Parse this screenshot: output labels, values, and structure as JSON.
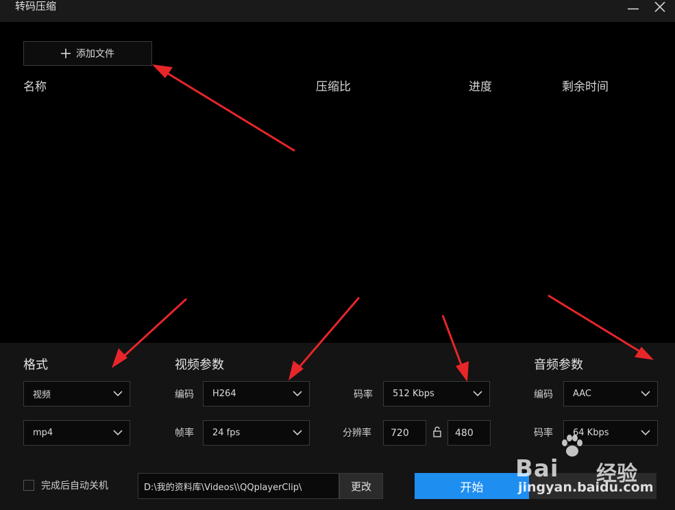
{
  "window": {
    "title": "转码压缩",
    "minimize_icon": "minimize-icon",
    "close_icon": "close-icon"
  },
  "toolbar": {
    "add_file_label": "添加文件",
    "add_icon": "plus-icon"
  },
  "file_table": {
    "columns": [
      "名称",
      "压缩比",
      "进度",
      "剩余时间"
    ],
    "rows": []
  },
  "format": {
    "title": "格式",
    "type_value": "视频",
    "container_value": "mp4"
  },
  "video": {
    "title": "视频参数",
    "codec_label": "编码",
    "codec_value": "H264",
    "framerate_label": "帧率",
    "framerate_value": "24 fps",
    "bitrate_label": "码率",
    "bitrate_value": "512 Kbps",
    "resolution_label": "分辨率",
    "width_value": "720",
    "height_value": "480",
    "lock_icon": "unlock-icon"
  },
  "audio": {
    "title": "音频参数",
    "codec_label": "编码",
    "codec_value": "AAC",
    "bitrate_label": "码率",
    "bitrate_value": "64 Kbps"
  },
  "footer": {
    "shutdown_label": "完成后自动关机",
    "shutdown_checked": false,
    "output_path": "D:\\我的资料库\\Videos\\\\QQplayerClip\\",
    "change_label": "更改",
    "start_label": "开始"
  },
  "watermark": {
    "brand": "Bai",
    "brand_cn": "经验",
    "url": "jingyan.baidu.com"
  },
  "colors": {
    "accent": "#1f8ef1",
    "annotation_arrow": "#e8262a",
    "panel_bg": "#141414",
    "main_bg": "#000000"
  }
}
